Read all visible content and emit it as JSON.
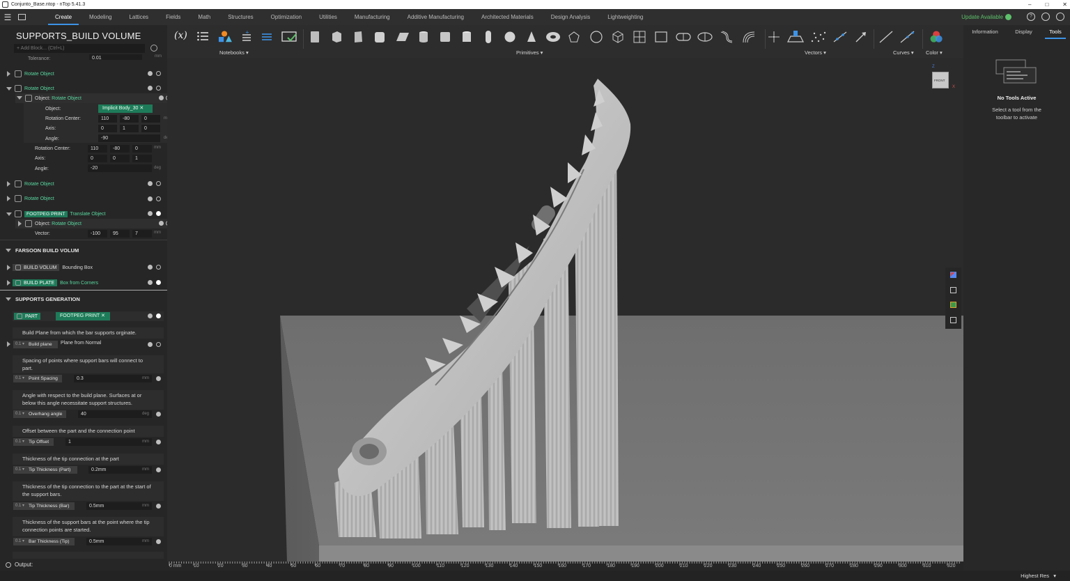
{
  "window": {
    "title": "Conjunto_Base.ntop - nTop 5.41.3",
    "controls": [
      "–",
      "□",
      "✕"
    ]
  },
  "menu": {
    "tabs": [
      "Create",
      "Modeling",
      "Lattices",
      "Fields",
      "Math",
      "Structures",
      "Optimization",
      "Utilities",
      "Manufacturing",
      "Additive Manufacturing",
      "Architected Materials",
      "Design Analysis",
      "Lightweighting"
    ],
    "active": "Create",
    "update_label": "Update Available"
  },
  "ribbon": {
    "var_label": "(x)",
    "groups": {
      "notebooks": "Notebooks",
      "primitives": "Primitives",
      "vectors": "Vectors",
      "curves": "Curves",
      "color": "Color"
    }
  },
  "left": {
    "notebook_title": "SUPPORTS_BUILD VOLUME",
    "add_block_placeholder": "Add Block... (Ctrl+L)",
    "tolerance": {
      "label": "Tolerance:",
      "value": "0.01",
      "unit": "mm"
    },
    "rotate1": "Rotate Object",
    "rotate2": {
      "title": "Rotate Object",
      "object": {
        "label": "Object:",
        "value": "Rotate Object"
      },
      "inner": {
        "object": {
          "label": "Object:",
          "chip": "Implicit Body_30"
        },
        "rot_center": {
          "label": "Rotation Center:",
          "x": "110",
          "y": "-80",
          "z": "0",
          "unit": "mm"
        },
        "axis": {
          "label": "Axis:",
          "x": "0",
          "y": "1",
          "z": "0"
        },
        "angle": {
          "label": "Angle:",
          "value": "-90",
          "unit": "deg"
        }
      },
      "rot_center": {
        "label": "Rotation Center:",
        "x": "110",
        "y": "-80",
        "z": "0",
        "unit": "mm"
      },
      "axis": {
        "label": "Axis:",
        "x": "0",
        "y": "0",
        "z": "1"
      },
      "angle": {
        "label": "Angle:",
        "value": "-20",
        "unit": "deg"
      }
    },
    "rotate3": "Rotate Object",
    "rotate4": "Rotate Object",
    "footpeg": {
      "name": "FOOTPEG PRINT",
      "type": "Translate Object",
      "object": {
        "label": "Object:",
        "value": "Rotate Object"
      },
      "vector": {
        "label": "Vector:",
        "x": "-100",
        "y": "95",
        "z": "7",
        "unit": "mm"
      }
    },
    "farsoon": {
      "title": "FARSOON BUILD VOLUM",
      "build_volum": {
        "name": "BUILD VOLUM",
        "type": "Bounding Box"
      },
      "build_plate": {
        "name": "BUILD PLATE",
        "type": "Box from Corners"
      }
    },
    "supports": {
      "title": "SUPPORTS GENERATION",
      "part": {
        "label": "PART",
        "chip": "FOOTPEG PRINT"
      },
      "build_plane_desc": "Build Plane from which the bar supports orginate.",
      "build_plane": {
        "name": "Build plane",
        "value": "Plane from Normal"
      },
      "spacing_desc": "Spacing of points where support bars will connect to part.",
      "point_spacing": {
        "name": "Point Spacing",
        "value": "0.3",
        "unit": "mm"
      },
      "overhang_desc": "Angle with respect to the build plane.  Surfaces at or below this angle necessitate support structures.",
      "overhang": {
        "name": "Overhang angle",
        "value": "40",
        "unit": "deg"
      },
      "offset_desc": "Offset between the part and the connection point",
      "tip_offset": {
        "name": "Tip Offset",
        "value": "1",
        "unit": "mm"
      },
      "tip_part_desc": "Thickness of the tip connection at the part",
      "tip_part": {
        "name": "Tip Thickness (Part)",
        "value": "0.2mm",
        "unit": "mm"
      },
      "tip_bar_desc": "Thickness of the tip connection to the part at the start of the support bars.",
      "tip_bar": {
        "name": "Tip Thickness (Bar)",
        "value": "0.5mm",
        "unit": "mm"
      },
      "bar_tip_desc": "Thickness of the support bars at the point where the tip connection points are started.",
      "bar_tip": {
        "name": "Bar Thickness (Tip)",
        "value": "0.5mm",
        "unit": "mm"
      }
    },
    "output_label": "Output:"
  },
  "right": {
    "tabs": [
      "Information",
      "Display",
      "Tools"
    ],
    "active": "Tools",
    "no_tools": "No Tools Active",
    "hint": "Select a tool from the toolbar to activate"
  },
  "viewcube": {
    "face": "FRONT",
    "z": "Z",
    "x": "X"
  },
  "ruler": {
    "ticks": [
      "0 mm",
      "10",
      "20",
      "30",
      "40",
      "50",
      "60",
      "70",
      "80",
      "90",
      "100",
      "110",
      "120",
      "130",
      "140",
      "150",
      "160",
      "170",
      "180",
      "190",
      "200",
      "210",
      "220",
      "230",
      "240",
      "250",
      "260",
      "270",
      "280",
      "290",
      "300",
      "310",
      "320"
    ]
  },
  "status": {
    "quality": "Highest Res"
  },
  "colors": {
    "accent": "#3d93e6",
    "green": "#59d7a0",
    "chip": "#1e7b5a",
    "update": "#5dc06a"
  }
}
